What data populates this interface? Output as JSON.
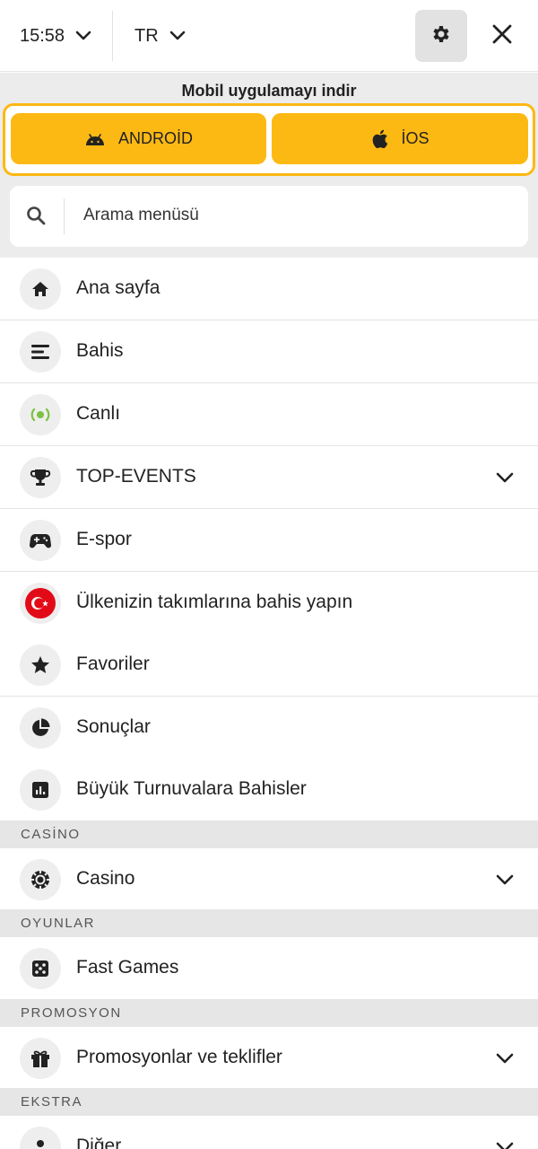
{
  "topbar": {
    "time": "15:58",
    "language": "TR",
    "icons": {
      "time_dropdown": "chevron-down-icon",
      "lang_dropdown": "chevron-down-icon",
      "settings": "gear-icon",
      "close": "close-icon"
    }
  },
  "download": {
    "title": "Mobil uygulamayı indir",
    "accent_color": "#fdb913",
    "android_label": "ANDROİD",
    "ios_label": "İOS"
  },
  "search": {
    "placeholder": "Arama menüsü",
    "icon": "search-icon"
  },
  "menu": {
    "items": [
      {
        "label": "Ana sayfa",
        "icon": "home-icon"
      },
      {
        "label": "Bahis",
        "icon": "list-icon"
      },
      {
        "label": "Canlı",
        "icon": "live-icon"
      },
      {
        "label": "TOP-EVENTS",
        "icon": "trophy-icon",
        "expandable": true
      },
      {
        "label": "E-spor",
        "icon": "gamepad-icon"
      },
      {
        "label": "Ülkenizin takımlarına bahis yapın",
        "icon": "turkey-flag-icon"
      },
      {
        "label": "Favoriler",
        "icon": "star-icon"
      },
      {
        "label": "Sonuçlar",
        "icon": "pie-chart-icon"
      },
      {
        "label": "Büyük Turnuvalara Bahisler",
        "icon": "bar-chart-icon"
      }
    ]
  },
  "sections": {
    "casino": {
      "header": "CASİNO",
      "items": [
        {
          "label": "Casino",
          "icon": "casino-chip-icon",
          "expandable": true
        }
      ]
    },
    "games": {
      "header": "OYUNLAR",
      "items": [
        {
          "label": "Fast Games",
          "icon": "dice-icon"
        }
      ]
    },
    "promo": {
      "header": "PROMOSYON",
      "items": [
        {
          "label": "Promosyonlar ve teklifler",
          "icon": "gift-icon",
          "expandable": true
        }
      ]
    },
    "extra": {
      "header": "EKSTRA",
      "items": [
        {
          "label": "Diğer",
          "icon": "users-icon",
          "expandable": true
        }
      ]
    }
  },
  "colors": {
    "live_green": "#7cc242",
    "flag_red": "#e30a17"
  }
}
